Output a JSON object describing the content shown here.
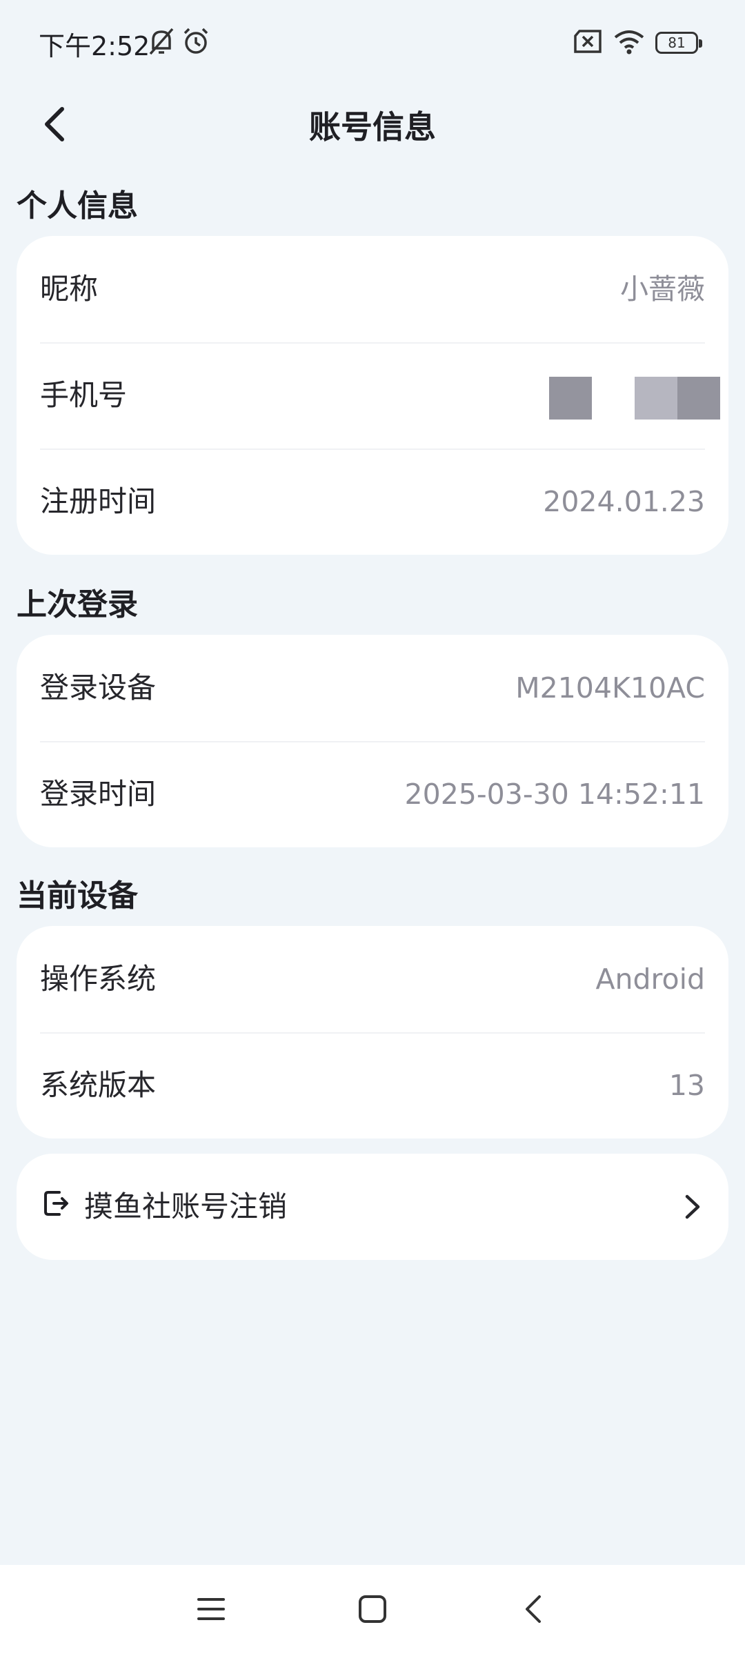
{
  "status_bar": {
    "time": "下午2:52",
    "icons": [
      "bell-off-icon",
      "alarm-icon",
      "sim-x-icon",
      "wifi-icon"
    ],
    "battery": "81"
  },
  "header": {
    "title": "账号信息"
  },
  "personal_info": {
    "title": "个人信息",
    "rows": [
      {
        "label": "昵称",
        "value": "小蔷薇"
      },
      {
        "label": "手机号",
        "value": ""
      },
      {
        "label": "注册时间",
        "value": "2024.01.23"
      }
    ]
  },
  "last_login": {
    "title": "上次登录",
    "rows": [
      {
        "label": "登录设备",
        "value": "M2104K10AC"
      },
      {
        "label": "登录时间",
        "value": "2025-03-30 14:52:11"
      }
    ]
  },
  "current_device": {
    "title": "当前设备",
    "rows": [
      {
        "label": "操作系统",
        "value": "Android"
      },
      {
        "label": "系统版本",
        "value": "13"
      }
    ]
  },
  "account_action": {
    "label": "摸鱼社账号注销",
    "icon": "logout-icon"
  },
  "nav_bar": {
    "icons": [
      "menu-icon",
      "home-icon",
      "back-icon"
    ]
  },
  "colors": {
    "background": "#f0f5f9",
    "card": "#ffffff",
    "value_text": "#8e8e98",
    "label_text": "#26262b"
  }
}
